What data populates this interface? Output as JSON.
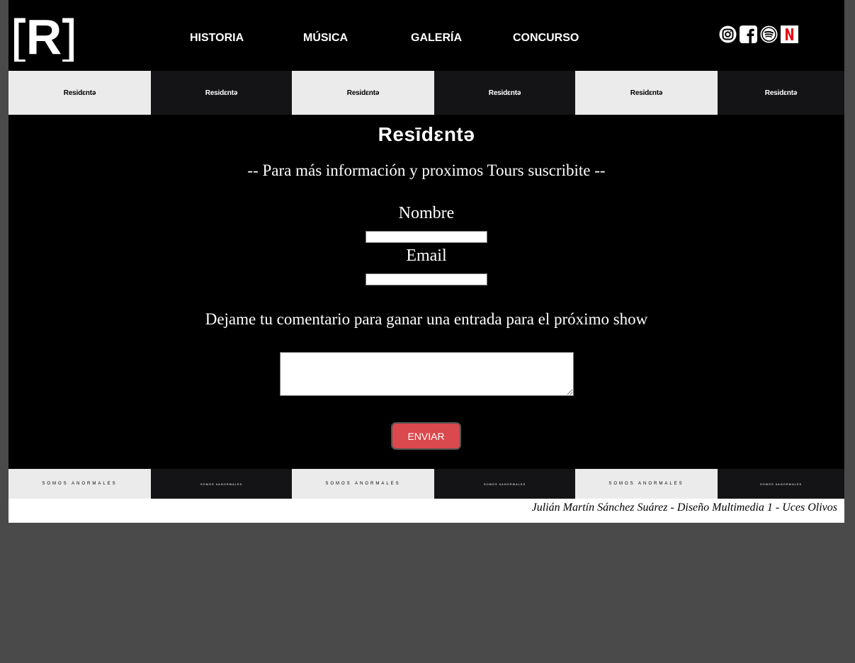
{
  "header": {
    "logo_text": "[R]",
    "nav": [
      {
        "label": "HISTORIA"
      },
      {
        "label": "MÚSICA"
      },
      {
        "label": "GALERÍA"
      },
      {
        "label": "CONCURSO"
      }
    ],
    "social_icons": [
      "instagram-icon",
      "facebook-icon",
      "spotify-icon",
      "netflix-icon"
    ]
  },
  "top_strip": {
    "tiles": [
      "Residɛntə",
      "Residɛntə",
      "Residɛntə",
      "Residɛntə",
      "Residɛntə",
      "Residɛntə"
    ]
  },
  "main": {
    "brand": "Resīdɛntə",
    "subtitle": "-- Para más información y proximos Tours suscribite --",
    "name_label": "Nombre",
    "email_label": "Email",
    "comment_prompt": "Dejame tu comentario para ganar una entrada para el próximo show",
    "submit_label": "ENVIAR"
  },
  "bottom_strip": {
    "tiles": [
      "SOMOS ANORMALES",
      "SOMOS #ANORMALES",
      "SOMOS ANORMALES",
      "SOMOS #ANORMALES",
      "SOMOS ANORMALES",
      "SOMOS #ANORMALES"
    ]
  },
  "footer": {
    "credit": "Julián Martín Sánchez Suárez - Diseño Multimedia 1 - Uces Olivos"
  },
  "colors": {
    "page_bg": "#4a4a4a",
    "content_bg": "#000000",
    "button": "#d9494d",
    "netflix_red": "#e50914"
  }
}
